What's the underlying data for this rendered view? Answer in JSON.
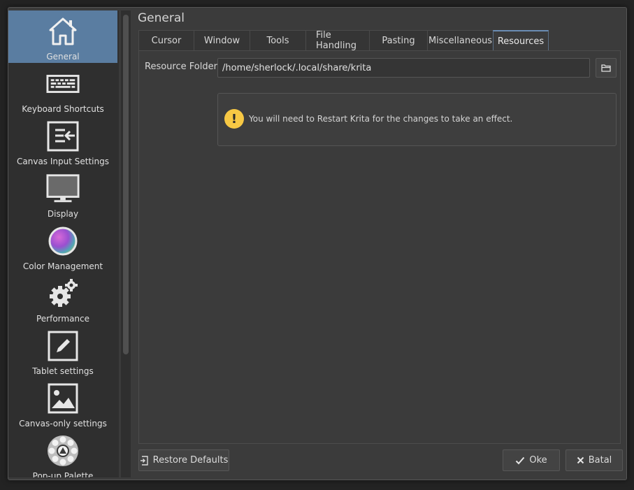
{
  "dialog": {
    "page_title": "General"
  },
  "sidebar": {
    "items": [
      {
        "label": "General",
        "icon": "home-icon",
        "active": true
      },
      {
        "label": "Keyboard Shortcuts",
        "icon": "keyboard-icon"
      },
      {
        "label": "Canvas Input Settings",
        "icon": "canvas-input-icon"
      },
      {
        "label": "Display",
        "icon": "monitor-icon"
      },
      {
        "label": "Color Management",
        "icon": "color-wheel-icon"
      },
      {
        "label": "Performance",
        "icon": "gears-icon"
      },
      {
        "label": "Tablet settings",
        "icon": "pen-icon"
      },
      {
        "label": "Canvas-only settings",
        "icon": "image-icon"
      },
      {
        "label": "Pop-up Palette",
        "icon": "palette-icon"
      }
    ]
  },
  "tabs": [
    {
      "label": "Cursor"
    },
    {
      "label": "Window"
    },
    {
      "label": "Tools"
    },
    {
      "label": "File Handling"
    },
    {
      "label": "Pasting"
    },
    {
      "label": "Miscellaneous"
    },
    {
      "label": "Resources",
      "active": true
    }
  ],
  "resources": {
    "folder_label": "Resource Folder:",
    "folder_value": "/home/sherlock/.local/share/krita",
    "notice": "You will need to Restart Krita for the changes to take an effect.",
    "notice_icon": "!"
  },
  "buttons": {
    "restore_defaults": "Restore Defaults",
    "ok": "Oke",
    "cancel": "Batal"
  },
  "colors": {
    "accent": "#5a7da1",
    "warning": "#f7c844"
  }
}
